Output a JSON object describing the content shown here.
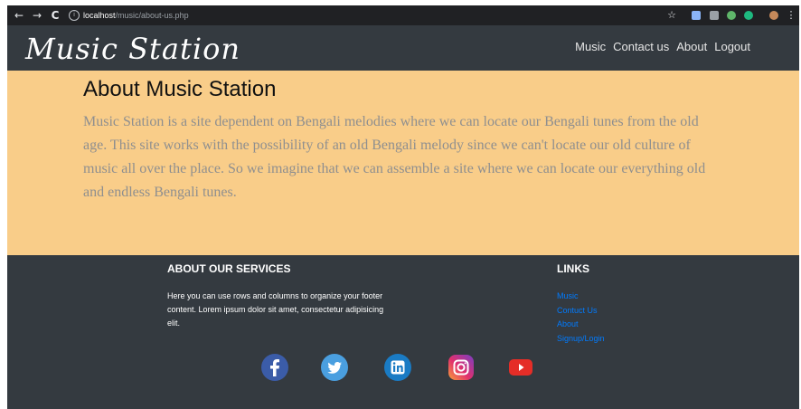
{
  "browser": {
    "url_host": "localhost",
    "url_path": "/music/about-us.php",
    "back_icon": "arrow-left-icon",
    "forward_icon": "arrow-right-icon",
    "reload_icon": "reload-icon"
  },
  "navbar": {
    "brand": "Music Station",
    "items": [
      {
        "label": "Music"
      },
      {
        "label": "Contact us"
      },
      {
        "label": "About"
      },
      {
        "label": "Logout"
      }
    ]
  },
  "about": {
    "title": "About Music Station",
    "description": "Music Station is a site dependent on Bengali melodies where we can locate our Bengali tunes from the old age. This site works with the possibility of an old Bengali melody since we can't locate our old culture of music all over the place. So we imagine that we can assemble a site where we can locate our everything old and endless Bengali tunes."
  },
  "footer": {
    "services_title": "ABOUT OUR SERVICES",
    "services_text": "Here you can use rows and columns to organize your footer content. Lorem ipsum dolor sit amet, consectetur adipisicing elit.",
    "links_title": "LINKS",
    "links": [
      {
        "label": "Music"
      },
      {
        "label": "Contuct Us"
      },
      {
        "label": "About"
      },
      {
        "label": "Signup/Login"
      }
    ],
    "social_icons": [
      "facebook-icon",
      "twitter-icon",
      "linkedin-icon",
      "instagram-icon",
      "youtube-icon"
    ]
  },
  "colors": {
    "navbar_bg": "#343a40",
    "content_bg": "#f9cd89",
    "link_blue": "#007bff"
  }
}
